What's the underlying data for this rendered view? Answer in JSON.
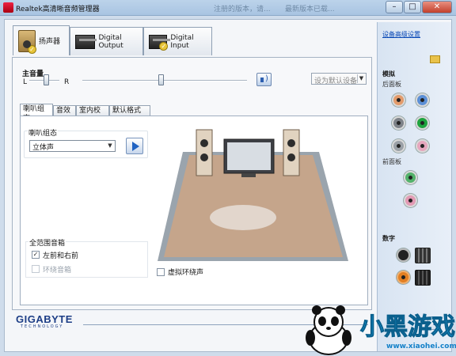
{
  "window": {
    "title": "Realtek高清晰音频管理器",
    "ghost_titles": [
      "注册的版本，请...",
      "最新版本已载..."
    ],
    "controls": [
      "–",
      "□",
      "✕"
    ]
  },
  "device_tabs": [
    {
      "label": "扬声器",
      "icon": "speaker-icon",
      "active": true
    },
    {
      "label": "Digital Output",
      "icon": "digital-output-icon",
      "active": false
    },
    {
      "label": "Digital Input",
      "icon": "digital-input-icon",
      "active": false
    }
  ],
  "volume": {
    "label": "主音量",
    "left": "L",
    "right": "R",
    "balance": 0.5,
    "level": 0.5,
    "default_device_label": "设为默认设备"
  },
  "sub_tabs": [
    "喇叭组态",
    "音效",
    "室内校正",
    "默认格式"
  ],
  "speaker_config": {
    "group_title": "喇叭组态",
    "selected": "立体声"
  },
  "full_range": {
    "group_title": "全范围音箱",
    "options": [
      {
        "label": "左前和右前",
        "checked": true,
        "disabled": false
      },
      {
        "label": "环绕音箱",
        "checked": false,
        "disabled": true
      }
    ]
  },
  "virtual_surround": {
    "label": "虚拟环绕声",
    "checked": false
  },
  "sidebar": {
    "advanced_link": "设备高级设置",
    "analog_title": "模拟",
    "rear_panel": "后面板",
    "front_panel": "前面板",
    "digital_title": "数字",
    "rear_jacks": [
      "#e39b6b",
      "#5b8fd6",
      "#7d8288",
      "#1ea33f",
      "#9aa0a6",
      "#e6a6bd"
    ],
    "front_jacks": [
      "#53b26b",
      "#e29ab4"
    ]
  },
  "brand": {
    "name": "GIGABYTE",
    "tagline": "TECHNOLOGY"
  },
  "info_button": "i",
  "watermark": {
    "title": "小黑游戏",
    "url": "www.xiaohei.com"
  }
}
